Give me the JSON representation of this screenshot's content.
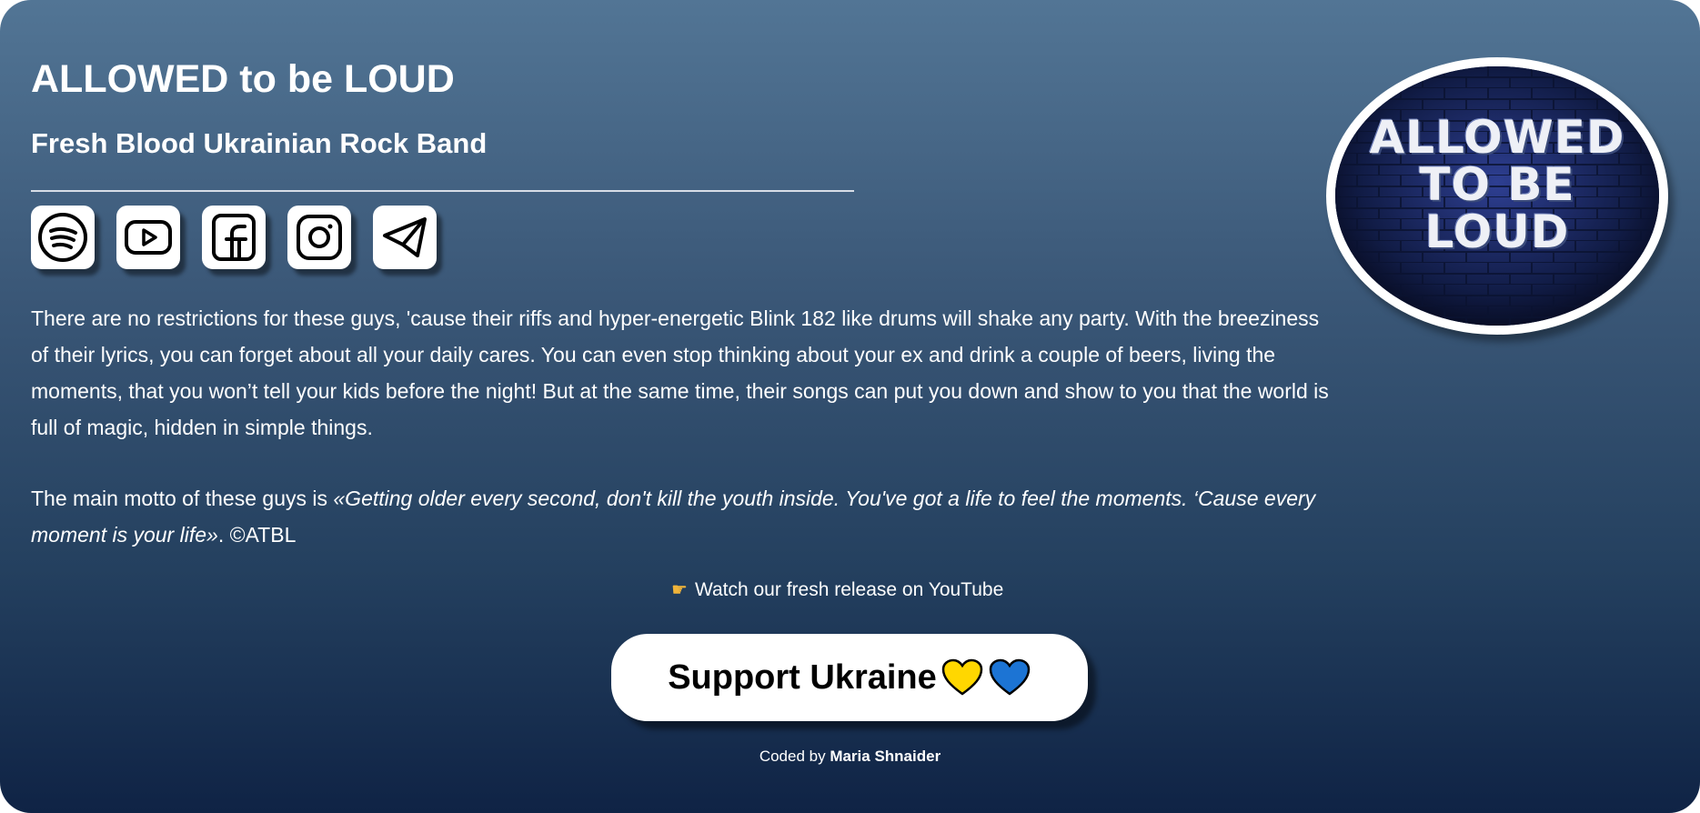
{
  "header": {
    "title": "ALLOWED to be LOUD",
    "subtitle": "Fresh Blood Ukrainian Rock Band"
  },
  "socials": [
    {
      "name": "Spotify",
      "icon": "spotify-icon"
    },
    {
      "name": "YouTube",
      "icon": "youtube-icon"
    },
    {
      "name": "Facebook",
      "icon": "facebook-icon"
    },
    {
      "name": "Instagram",
      "icon": "instagram-icon"
    },
    {
      "name": "Telegram",
      "icon": "telegram-icon"
    }
  ],
  "description": "There are no restrictions for these guys, 'cause their riffs and hyper-energetic Blink 182 like drums will shake any party. With the breeziness of their lyrics, you can forget about all your daily cares. You can even stop thinking about your ex and drink a couple of beers, living the moments, that you won’t tell your kids before the night! But at the same time, their songs can put you down and show to you that the world is full of magic, hidden in simple things.",
  "motto": {
    "prefix": "The main motto of these guys is ",
    "quote": "«Getting older every second, don't kill the youth inside. You've got a life to feel the moments. ‘Cause every moment is your life»",
    "suffix": ". ©ATBL"
  },
  "youtube_link": {
    "icon": "pointing-hand-icon",
    "label": "Watch our fresh release on YouTube"
  },
  "support_button": {
    "label": "Support Ukraine",
    "hearts": [
      "yellow-heart-icon",
      "blue-heart-icon"
    ]
  },
  "credit": {
    "prefix": "Coded by ",
    "author": "Maria Shnaider"
  },
  "logo": {
    "lines": [
      "ALLOWED",
      "TO BE",
      "LOUD"
    ]
  },
  "colors": {
    "gradient_top": "#527595",
    "gradient_bottom": "#0f2345",
    "heart_yellow": "#ffd700",
    "heart_blue": "#1c74d4"
  }
}
